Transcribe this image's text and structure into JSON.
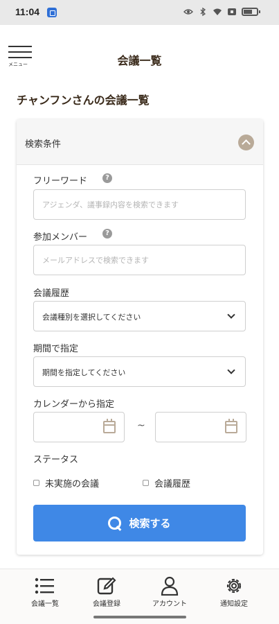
{
  "status_bar": {
    "time": "11:04",
    "icons": [
      "app-notification-icon",
      "eye-icon",
      "bluetooth-icon",
      "wifi-icon",
      "sim-icon",
      "battery-icon"
    ]
  },
  "header": {
    "menu_label": "メニュー",
    "title": "会議一覧"
  },
  "page_title": "チャンフンさんの会議一覧",
  "search_panel": {
    "header_label": "検索条件",
    "free_word": {
      "label": "フリーワード",
      "help": "?",
      "placeholder": "アジェンダ、議事録内容を検索できます",
      "value": ""
    },
    "members": {
      "label": "参加メンバー",
      "help": "?",
      "placeholder": "メールアドレスで検索できます",
      "value": ""
    },
    "meeting_history": {
      "label": "会議履歴",
      "selected": "会議種別を選択してください"
    },
    "period": {
      "label": "期間で指定",
      "selected": "期間を指定してください"
    },
    "calendar": {
      "label": "カレンダーから指定",
      "separator": "~"
    },
    "status": {
      "label": "ステータス",
      "options": [
        {
          "label": "未実施の会議",
          "checked": false
        },
        {
          "label": "会議履歴",
          "checked": false
        }
      ]
    },
    "search_button_label": "検索する"
  },
  "bottom_nav": {
    "items": [
      {
        "label": "会議一覧",
        "icon": "list-icon"
      },
      {
        "label": "会議登録",
        "icon": "edit-icon"
      },
      {
        "label": "アカウント",
        "icon": "user-icon"
      },
      {
        "label": "通知設定",
        "icon": "gear-icon"
      }
    ]
  },
  "colors": {
    "accent": "#3f88e6",
    "brand": "#b9aa98",
    "title_text": "#3a2a1a"
  }
}
